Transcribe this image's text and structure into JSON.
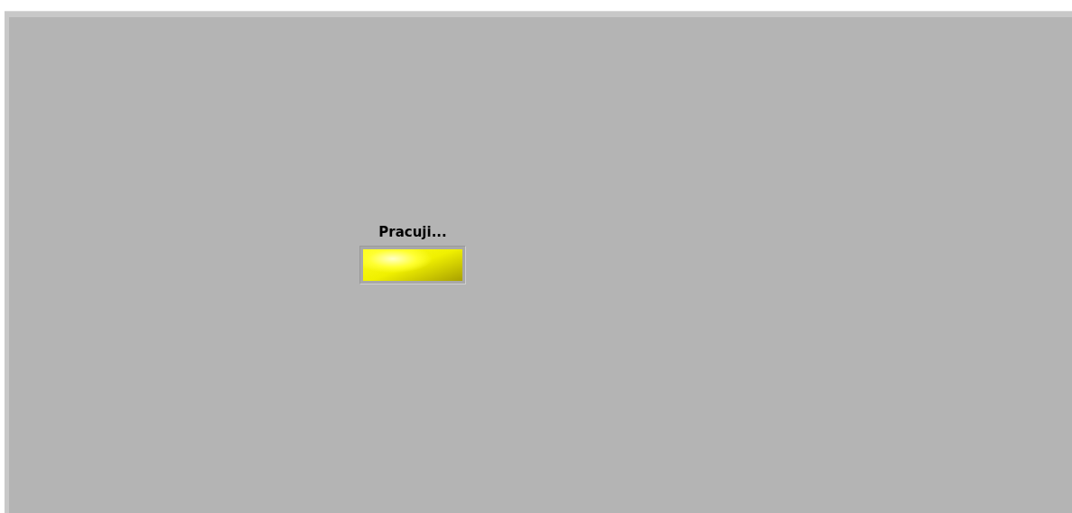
{
  "indicator": {
    "label": "Pracuji...",
    "on": true
  }
}
